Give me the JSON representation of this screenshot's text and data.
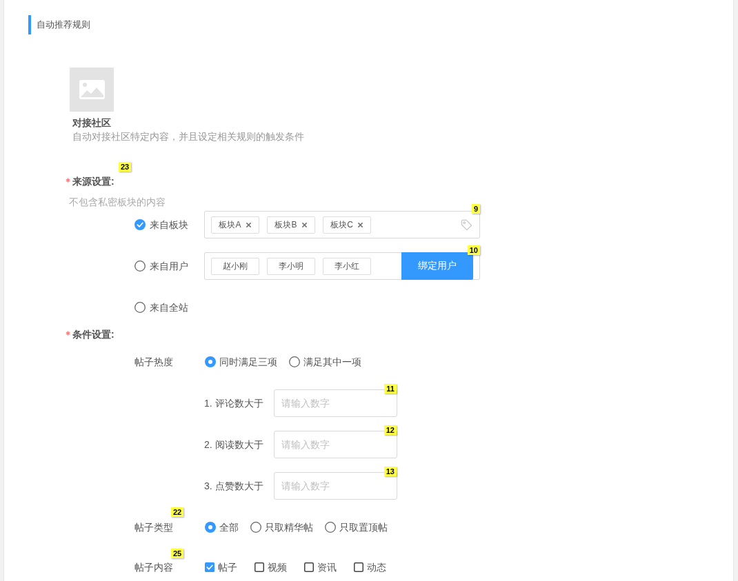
{
  "section": {
    "title": "自动推荐规则"
  },
  "intro": {
    "title": "对接社区",
    "description": "自动对接社区特定内容，并且设定相关规则的触发条件"
  },
  "source_settings": {
    "label": "来源设置:",
    "required": true,
    "marker": "23",
    "hint": "不包含私密板块的内容",
    "options": [
      {
        "kind": "tags",
        "label": "来自板块",
        "selected": true,
        "marker": "9",
        "tags": [
          "板块A",
          "板块B",
          "板块C"
        ]
      },
      {
        "kind": "users",
        "label": "来自用户",
        "selected": false,
        "marker": "10",
        "users": [
          "赵小刚",
          "李小明",
          "李小红"
        ],
        "button": "绑定用户"
      },
      {
        "kind": "plain",
        "label": "来自全站",
        "selected": false
      }
    ]
  },
  "conditions": {
    "label": "条件设置:",
    "required": true,
    "rows": [
      {
        "kind": "radio",
        "label": "帖子热度",
        "options": [
          {
            "label": "同时满足三项",
            "selected": true
          },
          {
            "label": "满足其中一项",
            "selected": false
          }
        ]
      },
      {
        "kind": "number",
        "label": "1. 评论数大于",
        "placeholder": "请输入数字",
        "marker": "11"
      },
      {
        "kind": "number",
        "label": "2. 阅读数大于",
        "placeholder": "请输入数字",
        "marker": "12"
      },
      {
        "kind": "number",
        "label": "3. 点赞数大于",
        "placeholder": "请输入数字",
        "marker": "13"
      },
      {
        "kind": "radio",
        "label": "帖子类型",
        "marker": "22",
        "options": [
          {
            "label": "全部",
            "selected": true
          },
          {
            "label": "只取精华帖",
            "selected": false
          },
          {
            "label": "只取置顶帖",
            "selected": false
          }
        ]
      },
      {
        "kind": "checkbox",
        "label": "帖子内容",
        "marker": "25",
        "options": [
          {
            "label": "帖子",
            "checked": true
          },
          {
            "label": "视频",
            "checked": false
          },
          {
            "label": "资讯",
            "checked": false
          },
          {
            "label": "动态",
            "checked": false
          }
        ]
      }
    ]
  }
}
